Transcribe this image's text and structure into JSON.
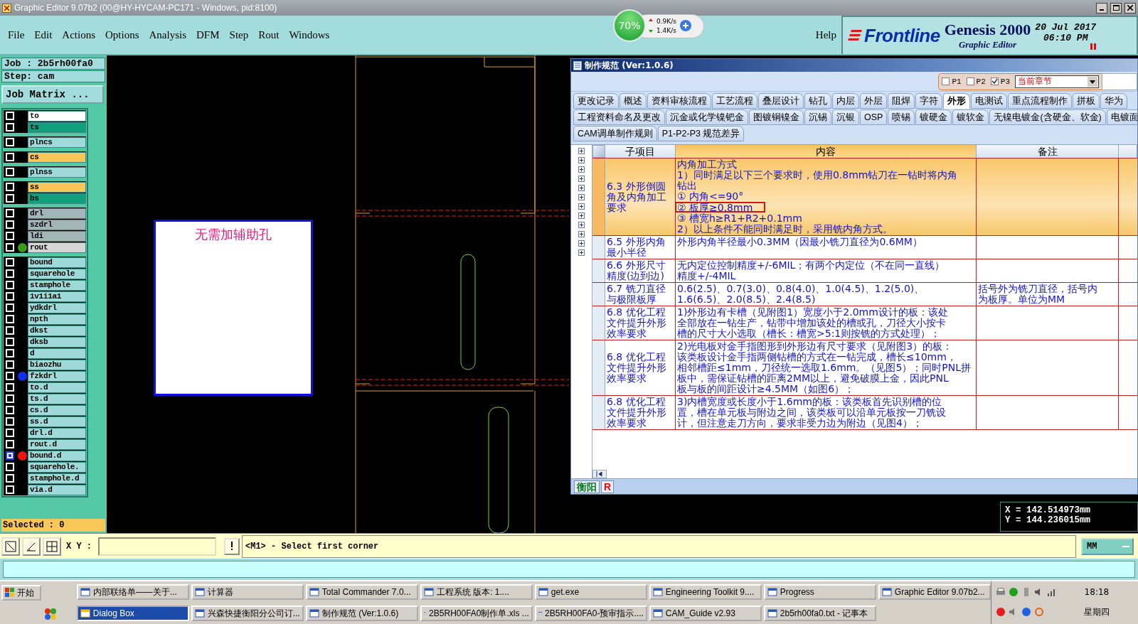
{
  "window": {
    "title": "Graphic Editor 9.07b2 (00@HY-HYCAM-PC171 - Windows, pid:8100)"
  },
  "menu": [
    "File",
    "Edit",
    "Actions",
    "Options",
    "Analysis",
    "DFM",
    "Step",
    "Rout",
    "Windows"
  ],
  "help": "Help",
  "net_widget": {
    "percent": "70%",
    "up": "0.9K/s",
    "down": "1.4K/s"
  },
  "brand": {
    "logo": "Frontline",
    "product": "Genesis 2000",
    "subtitle": "Graphic Editor",
    "date": "20 Jul 2017",
    "time": "06:10 PM"
  },
  "job": "Job : 2b5rh00fa0",
  "step": "Step: cam",
  "job_matrix": "Job Matrix ...",
  "layer_groups": [
    {
      "layers": [
        {
          "name": "to",
          "color": "#ffffff",
          "selected": false
        },
        {
          "name": "ts",
          "color": "#12a07c",
          "selected": false
        }
      ]
    },
    {
      "layers": [
        {
          "name": "plncs",
          "color": "#9fd9d9",
          "selected": false
        }
      ]
    },
    {
      "layers": [
        {
          "name": "cs",
          "color": "#f9c65a",
          "selected": false
        }
      ]
    },
    {
      "layers": [
        {
          "name": "plnss",
          "color": "#9fd9d9",
          "selected": false
        }
      ]
    },
    {
      "layers": [
        {
          "name": "ss",
          "color": "#f9c65a",
          "selected": false
        },
        {
          "name": "bs",
          "color": "#12a07c",
          "selected": false
        }
      ]
    },
    {
      "layers": [
        {
          "name": "drl",
          "color": "#a3b5b9",
          "selected": false
        },
        {
          "name": "szdrl",
          "color": "#a3b5b9",
          "selected": false
        },
        {
          "name": "ldi",
          "color": "#a3b5b9",
          "selected": false
        },
        {
          "name": "rout",
          "color": "#d6d6d6",
          "dot": {
            "color": "#3a9a1a"
          },
          "selected": false
        }
      ]
    },
    {
      "layers": [
        {
          "name": "bound",
          "color": "#9fd9d9",
          "selected": false
        },
        {
          "name": "squarehole",
          "color": "#9fd9d9",
          "selected": false
        },
        {
          "name": "stamphole",
          "color": "#9fd9d9",
          "selected": false
        },
        {
          "name": "1v1i1a1",
          "color": "#9fd9d9",
          "selected": false
        },
        {
          "name": "ydkdrl",
          "color": "#9fd9d9",
          "selected": false
        },
        {
          "name": "npth",
          "color": "#9fd9d9",
          "selected": false
        },
        {
          "name": "dkst",
          "color": "#9fd9d9",
          "selected": false
        },
        {
          "name": "dksb",
          "color": "#9fd9d9",
          "selected": false
        },
        {
          "name": "d",
          "color": "#9fd9d9",
          "selected": false
        },
        {
          "name": "biaozhu",
          "color": "#9fd9d9",
          "selected": false
        },
        {
          "name": "fzkdrl",
          "color": "#9fd9d9",
          "dot": {
            "color": "#1030f0"
          },
          "selected": false
        },
        {
          "name": "to.d",
          "color": "#9fd9d9",
          "selected": false
        },
        {
          "name": "ts.d",
          "color": "#9fd9d9",
          "selected": false
        },
        {
          "name": "cs.d",
          "color": "#9fd9d9",
          "selected": false
        },
        {
          "name": "ss.d",
          "color": "#9fd9d9",
          "selected": false
        },
        {
          "name": "drl.d",
          "color": "#9fd9d9",
          "selected": false
        },
        {
          "name": "rout.d",
          "color": "#9fd9d9",
          "selected": false
        },
        {
          "name": "bound.d",
          "color": "#9fd9d9",
          "dot": {
            "color": "#f01010"
          },
          "selected": true
        },
        {
          "name": "squarehole.",
          "color": "#9fd9d9",
          "selected": false
        },
        {
          "name": "stamphole.d",
          "color": "#9fd9d9",
          "selected": false
        },
        {
          "name": "via.d",
          "color": "#9fd9d9",
          "selected": false
        }
      ]
    }
  ],
  "selected_count": "Selected : 0",
  "canvas": {
    "note": "无需加辅助孔",
    "coord_x": "X = 142.514973mm",
    "coord_y": "Y = 144.236015mm"
  },
  "dialog": {
    "title": "制作规范 (Ver:1.0.6)",
    "filters": [
      {
        "label": "P1",
        "checked": false
      },
      {
        "label": "P2",
        "checked": false
      },
      {
        "label": "P3",
        "checked": true
      }
    ],
    "chapter_select": "当前章节",
    "tab_rows": [
      [
        {
          "label": "更改记录",
          "selected": false
        },
        {
          "label": "概述",
          "selected": false
        },
        {
          "label": "资料审核流程",
          "selected": false
        },
        {
          "label": "工艺流程",
          "selected": false
        },
        {
          "label": "叠层设计",
          "selected": false
        },
        {
          "label": "钻孔",
          "selected": false
        },
        {
          "label": "内层",
          "selected": false
        },
        {
          "label": "外层",
          "selected": false
        },
        {
          "label": "阻焊",
          "selected": false
        },
        {
          "label": "字符",
          "selected": false
        },
        {
          "label": "外形",
          "selected": true
        },
        {
          "label": "电测试",
          "selected": false
        },
        {
          "label": "重点流程制作",
          "selected": false
        },
        {
          "label": "拼板",
          "selected": false
        },
        {
          "label": "华为",
          "selected": false
        }
      ],
      [
        {
          "label": "工程资料命名及更改",
          "selected": false
        },
        {
          "label": "沉金或化学镍钯金",
          "selected": false
        },
        {
          "label": "图镀铜镍金",
          "selected": false
        },
        {
          "label": "沉锡",
          "selected": false
        },
        {
          "label": "沉银",
          "selected": false
        },
        {
          "label": "OSP",
          "selected": false
        },
        {
          "label": "喷锡",
          "selected": false
        },
        {
          "label": "镀硬金",
          "selected": false
        },
        {
          "label": "镀软金",
          "selected": false
        },
        {
          "label": "无镍电镀金(含硬金、软金)",
          "selected": false
        },
        {
          "label": "电镀面",
          "selected": false
        }
      ],
      [
        {
          "label": "CAM调单制作规则",
          "selected": false
        },
        {
          "label": "P1-P2-P3 规范差异",
          "selected": false
        }
      ]
    ],
    "columns": [
      "子项目",
      "内容",
      "备注"
    ],
    "rows": [
      {
        "item": [
          "6.3 外形倒圆",
          "角及内角加工",
          "要求"
        ],
        "content": [
          "内角加工方式",
          "1）同时满足以下三个要求时，使用0.8mm钻刀在一钻时将内角",
          "钻出",
          "① 内角<=90°",
          {
            "text": "② 板厚≥0.8mm",
            "framed": true
          },
          "③ 槽宽h≥R1+R2+0.1mm",
          "2）以上条件不能同时满足时，采用铣内角方式。"
        ],
        "note": [],
        "selected": true
      },
      {
        "item": [
          "6.5 外形内角",
          "最小半径"
        ],
        "content": [
          "外形内角半径最小0.3MM（因最小铣刀直径为0.6MM）"
        ],
        "note": [],
        "selected": false
      },
      {
        "item": [
          "6.6 外形尺寸",
          "精度(边到边)"
        ],
        "content": [
          "无内定位控制精度+/-6MIL；有两个内定位（不在同一直线）",
          "精度+/-4MIL"
        ],
        "note": [],
        "selected": false
      },
      {
        "item": [
          "6.7 铣刀直径",
          "与极限板厚"
        ],
        "content": [
          "0.6(2.5)、0.7(3.0)、0.8(4.0)、1.0(4.5)、1.2(5.0)、",
          "1.6(6.5)、2.0(8.5)、2.4(8.5)"
        ],
        "note": [
          "括号外为铣刀直径，括号内",
          "为板厚。单位为MM"
        ],
        "selected": false
      },
      {
        "item": [
          "6.8 优化工程",
          "文件提升外形",
          "效率要求"
        ],
        "content": [
          "1)外形边有卡槽（见附图1）宽度小于2.0mm设计的板：该处",
          "全部放在一钻生产，钻带中增加该处的槽或孔，刀径大小按卡",
          "槽的尺寸大小选取（槽长：槽宽>5:1则按铣的方式处理）；"
        ],
        "note": [],
        "selected": false
      },
      {
        "item": [
          "6.8 优化工程",
          "文件提升外形",
          "效率要求"
        ],
        "content": [
          "2)光电板对金手指图形到外形边有尺寸要求（见附图3）的板：",
          "该类板设计金手指两侧钻槽的方式在一钻完成，槽长≤10mm，",
          "相邻槽距≤1mm，刀径统一选取1.6mm。（见图5）；同时PNL拼",
          "板中，需保证钻槽的距离2MM以上，避免破膜上金，因此PNL",
          "板与板的间距设计≥4.5MM（如图6）；"
        ],
        "note": [],
        "selected": false
      },
      {
        "item": [
          "6.8 优化工程",
          "文件提升外形",
          "效率要求"
        ],
        "content": [
          "3)内槽宽度或长度小于1.6mm的板：该类板首先识别槽的位",
          "置，槽在单元板与附边之间，该类板可以沿单元板按一刀铣设",
          "计，但注意走刀方向，要求非受力边为附边（见图4）；"
        ],
        "note": [],
        "selected": false
      }
    ],
    "bottom_tabs": [
      {
        "label": "衡阳",
        "color": "#0a7a20"
      },
      {
        "label": "R",
        "color": "#e01010"
      }
    ]
  },
  "command": {
    "xy_label": "X Y :",
    "prompt": "<M1> - Select first corner",
    "units": "MM"
  },
  "taskbar": {
    "start": "开始",
    "row_1": [
      {
        "label": "内部联络单——关于...",
        "selected": false
      },
      {
        "label": "计算器",
        "selected": false
      },
      {
        "label": "Total Commander 7.0...",
        "selected": false
      },
      {
        "label": "工程系统  版本: 1....",
        "selected": false
      },
      {
        "label": "get.exe",
        "selected": false
      },
      {
        "label": "Engineering Toolkit 9....",
        "selected": false
      },
      {
        "label": "Progress",
        "selected": false
      },
      {
        "label": "Graphic Editor 9.07b2...",
        "selected": false
      }
    ],
    "row_2": [
      {
        "label": "Dialog Box",
        "selected": true
      },
      {
        "label": "兴森快捷衡阳分公司订...",
        "selected": false
      },
      {
        "label": "制作规范 (Ver:1.0.6)",
        "selected": false
      },
      {
        "label": "2B5RH00FA0制作单.xls ...",
        "selected": false
      },
      {
        "label": "2B5RH00FA0-预审指示....",
        "selected": false
      },
      {
        "label": "CAM_Guide v2.93",
        "selected": false
      },
      {
        "label": "2b5rh00fa0.txt - 记事本",
        "selected": false
      }
    ],
    "clock": "18:18",
    "day": "星期四"
  }
}
